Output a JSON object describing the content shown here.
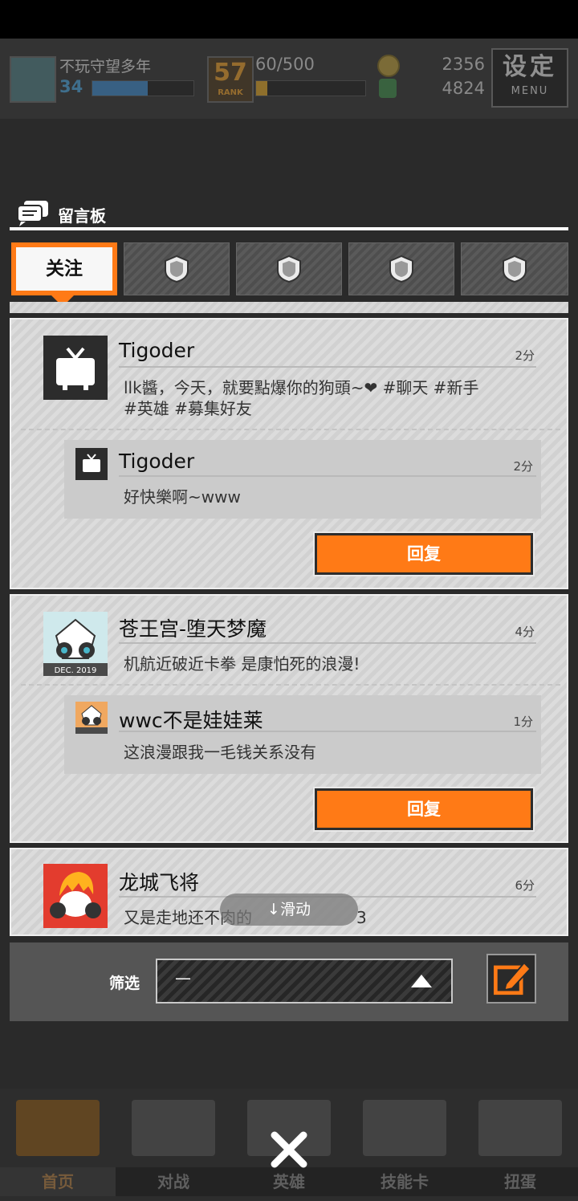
{
  "player": {
    "name": "不玩守望多年",
    "level": "34",
    "xp_fraction": 0.55,
    "rank": "57",
    "rank_label": "RANK",
    "stamina": "60/500",
    "stamina_fraction": 0.1,
    "coins": "2356",
    "gems": "4824"
  },
  "menu": {
    "title": "设定",
    "sub": "MENU"
  },
  "board": {
    "title": "留言板"
  },
  "tabs": [
    {
      "label": "关注",
      "active": true,
      "icon": ""
    },
    {
      "label": "",
      "icon": "shield-icon"
    },
    {
      "label": "",
      "icon": "shield-icon"
    },
    {
      "label": "",
      "icon": "shield-icon"
    },
    {
      "label": "",
      "icon": "shield-icon"
    }
  ],
  "posts": [
    {
      "author": "Tigoder",
      "time": "2分",
      "message_line1": "llk醬，今天，就要點爆你的狗頭~❤ #聊天 #新手",
      "message_line2": "#英雄 #募集好友",
      "avatar_icon": "tv-icon",
      "reply": {
        "author": "Tigoder",
        "time": "2分",
        "message": "好快樂啊~www",
        "avatar_icon": "tv-icon"
      },
      "reply_button": "回复"
    },
    {
      "author": "苍王宫-堕天梦魔",
      "time": "4分",
      "message_line1": "机航近破近卡拳  是康怕死的浪漫!",
      "avatar_icon": "robot-avatar-icon",
      "avatar_badge": "DEC. 2019",
      "reply": {
        "author": "wwc不是娃娃莱",
        "time": "1分",
        "message": "这浪漫跟我一毛钱关系没有",
        "avatar_icon": "robot-avatar-icon"
      },
      "reply_button": "回复"
    },
    {
      "author": "龙城飞将",
      "time": "6分",
      "message_line1": "又是走地还不肉的",
      "message_tail": "3",
      "avatar_icon": "orange-hair-avatar-icon"
    }
  ],
  "scroll_hint": "↓滑动",
  "filter": {
    "label": "筛选",
    "value": "—"
  },
  "nav": [
    {
      "label": "首页",
      "icon": "return-icon"
    },
    {
      "label": "对战",
      "icon": "gamepad-icon"
    },
    {
      "label": "英雄",
      "icon": "hero-icon"
    },
    {
      "label": "技能卡",
      "icon": "cards-icon"
    },
    {
      "label": "扭蛋",
      "icon": "capsule-icon"
    }
  ],
  "colors": {
    "accent": "#ff7a16",
    "panel": "#dcdcdc"
  }
}
